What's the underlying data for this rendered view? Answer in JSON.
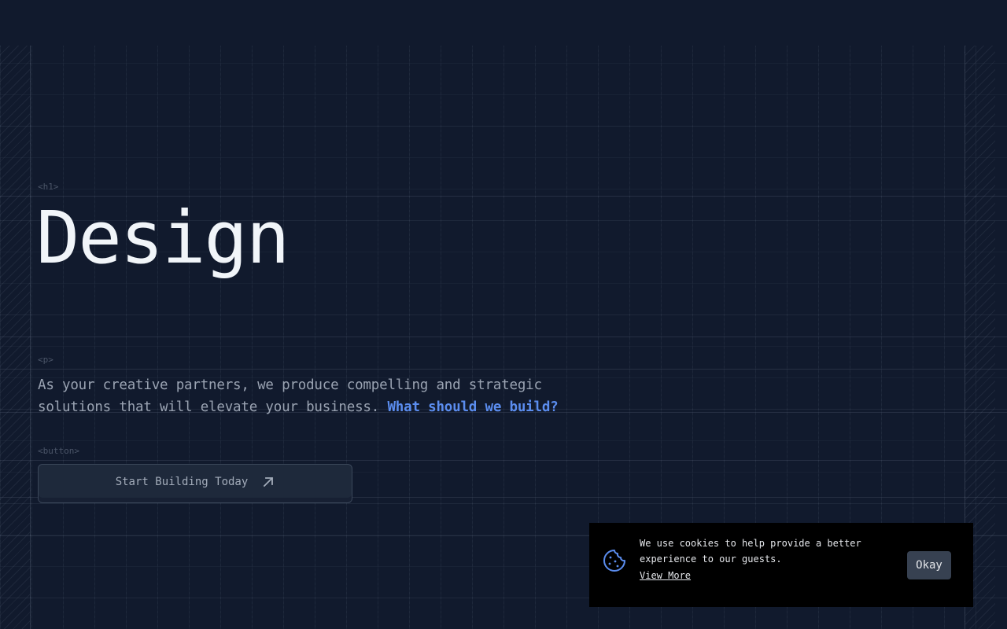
{
  "hero": {
    "h1_tag": "<h1>",
    "title": "Design",
    "p_tag": "<p>",
    "lede": "As your creative partners, we produce compelling and strategic solutions that will elevate your business.",
    "lede_link": "What should we build?",
    "button_tag": "<button>",
    "cta_label": "Start Building Today",
    "cta_icon": "arrow-up-right-icon"
  },
  "cookie_banner": {
    "icon": "cookie-icon",
    "message": "We use cookies to help provide a better experience to our guests.",
    "link_label": "View More",
    "accept_label": "Okay"
  },
  "colors": {
    "background": "#111a2d",
    "title": "#f1f5f9",
    "body_text": "#9aa3b2",
    "link": "#5b8def",
    "button_bg": "#1e293b",
    "cookie_bg": "#000000",
    "cookie_icon": "#5b8def",
    "okay_bg": "#374151"
  }
}
